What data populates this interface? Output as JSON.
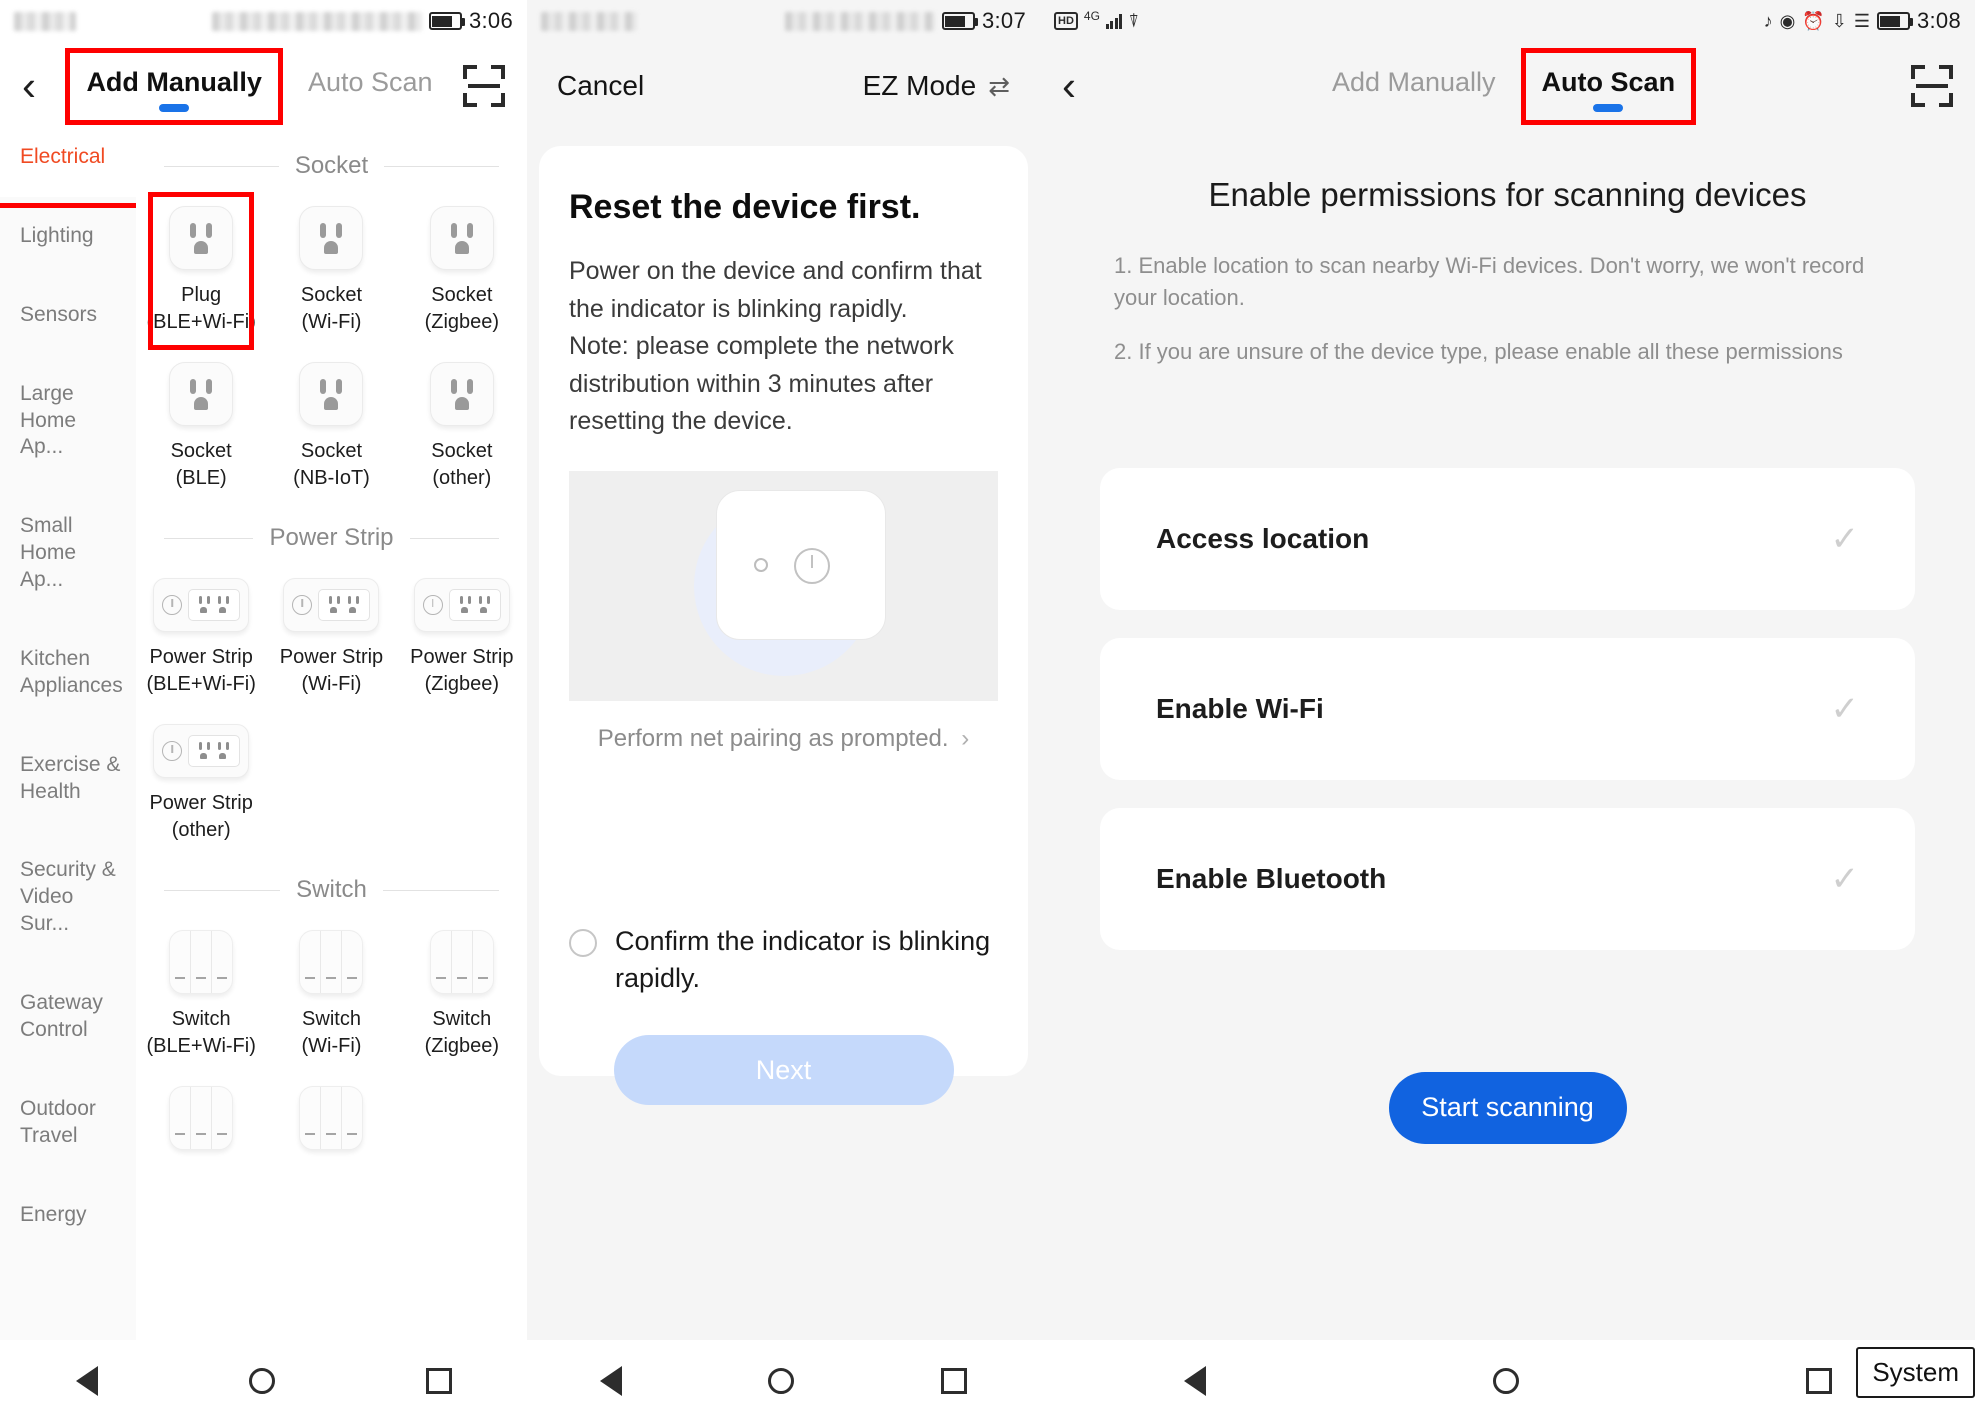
{
  "panel1": {
    "status_bar": {
      "time": "3:06",
      "battery_icon": "battery-icon"
    },
    "header": {
      "back_icon": "back-chevron-icon",
      "scan_icon": "scan-qr-icon",
      "tabs": [
        {
          "label": "Add Manually",
          "active": true,
          "highlighted": true
        },
        {
          "label": "Auto Scan",
          "active": false,
          "highlighted": false
        }
      ]
    },
    "sidebar": {
      "items": [
        {
          "label": "Electrical",
          "selected": true,
          "highlighted": true
        },
        {
          "label": "Lighting",
          "selected": false
        },
        {
          "label": "Sensors",
          "selected": false
        },
        {
          "label": "Large\nHome Ap...",
          "selected": false
        },
        {
          "label": "Small\nHome Ap...",
          "selected": false
        },
        {
          "label": "Kitchen\nAppliances",
          "selected": false
        },
        {
          "label": "Exercise &\nHealth",
          "selected": false
        },
        {
          "label": "Security &\nVideo Sur...",
          "selected": false
        },
        {
          "label": "Gateway\nControl",
          "selected": false
        },
        {
          "label": "Outdoor\nTravel",
          "selected": false
        },
        {
          "label": "Energy",
          "selected": false
        }
      ]
    },
    "sections": [
      {
        "title": "Socket",
        "devices": [
          {
            "name": "Plug",
            "variant": "(BLE+Wi-Fi)",
            "art": "socket",
            "highlighted": true
          },
          {
            "name": "Socket",
            "variant": "(Wi-Fi)",
            "art": "socket",
            "highlighted": false
          },
          {
            "name": "Socket",
            "variant": "(Zigbee)",
            "art": "socket",
            "highlighted": false
          },
          {
            "name": "Socket",
            "variant": "(BLE)",
            "art": "socket",
            "highlighted": false
          },
          {
            "name": "Socket",
            "variant": "(NB-IoT)",
            "art": "socket",
            "highlighted": false
          },
          {
            "name": "Socket",
            "variant": "(other)",
            "art": "socket",
            "highlighted": false
          }
        ]
      },
      {
        "title": "Power Strip",
        "devices": [
          {
            "name": "Power Strip",
            "variant": "(BLE+Wi-Fi)",
            "art": "strip",
            "highlighted": false
          },
          {
            "name": "Power Strip",
            "variant": "(Wi-Fi)",
            "art": "strip",
            "highlighted": false
          },
          {
            "name": "Power Strip",
            "variant": "(Zigbee)",
            "art": "strip",
            "highlighted": false
          },
          {
            "name": "Power Strip",
            "variant": "(other)",
            "art": "strip",
            "highlighted": false
          }
        ]
      },
      {
        "title": "Switch",
        "devices": [
          {
            "name": "Switch",
            "variant": "(BLE+Wi-Fi)",
            "art": "switch",
            "highlighted": false
          },
          {
            "name": "Switch",
            "variant": "(Wi-Fi)",
            "art": "switch",
            "highlighted": false
          },
          {
            "name": "Switch",
            "variant": "(Zigbee)",
            "art": "switch",
            "highlighted": false
          }
        ]
      }
    ]
  },
  "panel2": {
    "status_bar": {
      "time": "3:07",
      "battery_icon": "battery-icon"
    },
    "header": {
      "cancel_label": "Cancel",
      "mode_label": "EZ Mode",
      "mode_switch_icon": "swap-arrows-icon"
    },
    "card": {
      "title": "Reset the device first.",
      "body_line_1": "Power on the device and confirm that the indicator is blinking rapidly.",
      "body_line_2": "Note: please complete the network distribution within 3 minutes after resetting the device.",
      "hint": "Perform net pairing as prompted.",
      "hint_chevron": "chevron-right-icon",
      "illustration_icon": "smart-plug-illustration",
      "confirm_label": "Confirm the indicator is blinking rapidly.",
      "confirm_checked": false,
      "next_label": "Next",
      "next_disabled": true
    }
  },
  "panel3": {
    "status_bar": {
      "time": "3:08",
      "left_icons": [
        "hd-icon",
        "4g-signal-icon",
        "wifi-icon"
      ],
      "right_icons": [
        "headphones-icon",
        "eye-icon",
        "alarm-icon",
        "bluetooth-icon",
        "vibrate-icon",
        "battery-icon"
      ]
    },
    "header": {
      "back_icon": "back-chevron-icon",
      "scan_icon": "scan-qr-icon",
      "tabs": [
        {
          "label": "Add Manually",
          "active": false,
          "highlighted": false
        },
        {
          "label": "Auto Scan",
          "active": true,
          "highlighted": true
        }
      ]
    },
    "title": "Enable permissions for scanning devices",
    "notes": [
      "1. Enable location to scan nearby Wi-Fi devices. Don't worry, we won't record your location.",
      "2. If you are unsure of the device type, please enable all these permissions"
    ],
    "permissions": [
      {
        "label": "Access location",
        "check_icon": "check-icon"
      },
      {
        "label": "Enable Wi-Fi",
        "check_icon": "check-icon"
      },
      {
        "label": "Enable Bluetooth",
        "check_icon": "check-icon"
      }
    ],
    "start_button": "Start scanning",
    "system_chip": "System"
  },
  "navbar": {
    "back_icon": "nav-back-triangle-icon",
    "home_icon": "nav-home-circle-icon",
    "recents_icon": "nav-recents-square-icon"
  },
  "colors": {
    "accent_blue": "#1163e0",
    "tab_underline": "#1a73e8",
    "highlight_red": "#fe0000",
    "selected_category": "#f04a22",
    "next_disabled": "#c5d9fb"
  }
}
